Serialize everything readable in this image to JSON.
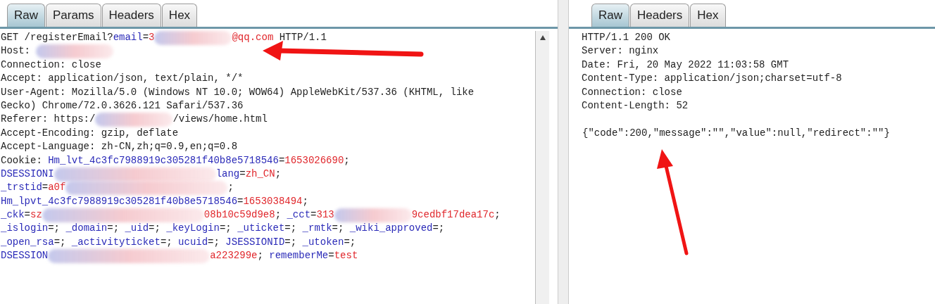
{
  "request": {
    "tabs": [
      {
        "label": "Raw",
        "selected": true
      },
      {
        "label": "Params",
        "selected": false
      },
      {
        "label": "Headers",
        "selected": false
      },
      {
        "label": "Hex",
        "selected": false
      }
    ],
    "lines": [
      {
        "segments": [
          {
            "kind": "text",
            "text": "GET /registerEmail?"
          },
          {
            "kind": "name",
            "text": "email"
          },
          {
            "kind": "text",
            "text": "="
          },
          {
            "kind": "value",
            "text": "3"
          },
          {
            "kind": "smear"
          },
          {
            "kind": "value",
            "text": "@qq.com"
          },
          {
            "kind": "text",
            "text": " HTTP/1.1"
          }
        ]
      },
      {
        "segments": [
          {
            "kind": "text",
            "text": "Host: "
          },
          {
            "kind": "smear"
          }
        ]
      },
      {
        "segments": [
          {
            "kind": "text",
            "text": "Connection: close"
          }
        ]
      },
      {
        "segments": [
          {
            "kind": "text",
            "text": "Accept: application/json, text/plain, */*"
          }
        ]
      },
      {
        "segments": [
          {
            "kind": "text",
            "text": "User-Agent: Mozilla/5.0 (Windows NT 10.0; WOW64) AppleWebKit/537.36 (KHTML, like"
          }
        ]
      },
      {
        "segments": [
          {
            "kind": "text",
            "text": "Gecko) Chrome/72.0.3626.121 Safari/537.36"
          }
        ]
      },
      {
        "segments": [
          {
            "kind": "text",
            "text": "Referer: https:/"
          },
          {
            "kind": "smear"
          },
          {
            "kind": "text",
            "text": "/views/home.html"
          }
        ]
      },
      {
        "segments": [
          {
            "kind": "text",
            "text": "Accept-Encoding: gzip, deflate"
          }
        ]
      },
      {
        "segments": [
          {
            "kind": "text",
            "text": "Accept-Language: zh-CN,zh;q=0.9,en;q=0.8"
          }
        ]
      },
      {
        "segments": [
          {
            "kind": "text",
            "text": "Cookie: "
          },
          {
            "kind": "name",
            "text": "Hm_lvt_4c3fc7988919c305281f40b8e5718546"
          },
          {
            "kind": "text",
            "text": "="
          },
          {
            "kind": "value",
            "text": "1653026690"
          },
          {
            "kind": "text",
            "text": ";"
          }
        ]
      },
      {
        "segments": [
          {
            "kind": "name",
            "text": "DSESSIONI"
          },
          {
            "kind": "longsmear"
          },
          {
            "kind": "name",
            "text": "lang"
          },
          {
            "kind": "text",
            "text": "="
          },
          {
            "kind": "value",
            "text": "zh_CN"
          },
          {
            "kind": "text",
            "text": ";"
          }
        ]
      },
      {
        "segments": [
          {
            "kind": "name",
            "text": "_trstid"
          },
          {
            "kind": "text",
            "text": "="
          },
          {
            "kind": "value",
            "text": "a0f"
          },
          {
            "kind": "longsmear"
          },
          {
            "kind": "text",
            "text": ";"
          }
        ]
      },
      {
        "segments": [
          {
            "kind": "name",
            "text": "Hm_lpvt_4c3fc7988919c305281f40b8e5718546"
          },
          {
            "kind": "text",
            "text": "="
          },
          {
            "kind": "value",
            "text": "1653038494"
          },
          {
            "kind": "text",
            "text": ";"
          }
        ]
      },
      {
        "segments": [
          {
            "kind": "name",
            "text": "_ckk"
          },
          {
            "kind": "text",
            "text": "="
          },
          {
            "kind": "value",
            "text": "sz"
          },
          {
            "kind": "longsmear"
          },
          {
            "kind": "value",
            "text": "08b10c59d9e8"
          },
          {
            "kind": "text",
            "text": "; "
          },
          {
            "kind": "name",
            "text": "_cct"
          },
          {
            "kind": "text",
            "text": "="
          },
          {
            "kind": "value",
            "text": "313"
          },
          {
            "kind": "smear"
          },
          {
            "kind": "value",
            "text": "9cedbf17dea17c"
          },
          {
            "kind": "text",
            "text": ";"
          }
        ]
      },
      {
        "segments": [
          {
            "kind": "name",
            "text": "_islogin"
          },
          {
            "kind": "text",
            "text": "=; "
          },
          {
            "kind": "name",
            "text": "_domain"
          },
          {
            "kind": "text",
            "text": "=; "
          },
          {
            "kind": "name",
            "text": "_uid"
          },
          {
            "kind": "text",
            "text": "=; "
          },
          {
            "kind": "name",
            "text": "_keyLogin"
          },
          {
            "kind": "text",
            "text": "=; "
          },
          {
            "kind": "name",
            "text": "_uticket"
          },
          {
            "kind": "text",
            "text": "=; "
          },
          {
            "kind": "name",
            "text": "_rmtk"
          },
          {
            "kind": "text",
            "text": "=; "
          },
          {
            "kind": "name",
            "text": "_wiki_approved"
          },
          {
            "kind": "text",
            "text": "=;"
          }
        ]
      },
      {
        "segments": [
          {
            "kind": "name",
            "text": "_open_rsa"
          },
          {
            "kind": "text",
            "text": "=; "
          },
          {
            "kind": "name",
            "text": "_activityticket"
          },
          {
            "kind": "text",
            "text": "=; "
          },
          {
            "kind": "name",
            "text": "ucuid"
          },
          {
            "kind": "text",
            "text": "=; "
          },
          {
            "kind": "name",
            "text": "JSESSIONID"
          },
          {
            "kind": "text",
            "text": "=; "
          },
          {
            "kind": "name",
            "text": "_utoken"
          },
          {
            "kind": "text",
            "text": "=;"
          }
        ]
      },
      {
        "segments": [
          {
            "kind": "name",
            "text": "DSESSION"
          },
          {
            "kind": "longsmear"
          },
          {
            "kind": "value",
            "text": "a223299e"
          },
          {
            "kind": "text",
            "text": "; "
          },
          {
            "kind": "name",
            "text": "rememberMe"
          },
          {
            "kind": "text",
            "text": "="
          },
          {
            "kind": "value",
            "text": "test"
          }
        ]
      }
    ]
  },
  "response": {
    "tabs": [
      {
        "label": "Raw",
        "selected": true
      },
      {
        "label": "Headers",
        "selected": false
      },
      {
        "label": "Hex",
        "selected": false
      }
    ],
    "headers": [
      "HTTP/1.1 200 OK",
      "Server: nginx",
      "Date: Fri, 20 May 2022 11:03:58 GMT",
      "Content-Type: application/json;charset=utf-8",
      "Connection: close",
      "Content-Length: 52"
    ],
    "body": "{\"code\":200,\"message\":\"\",\"value\":null,\"redirect\":\"\"}"
  }
}
